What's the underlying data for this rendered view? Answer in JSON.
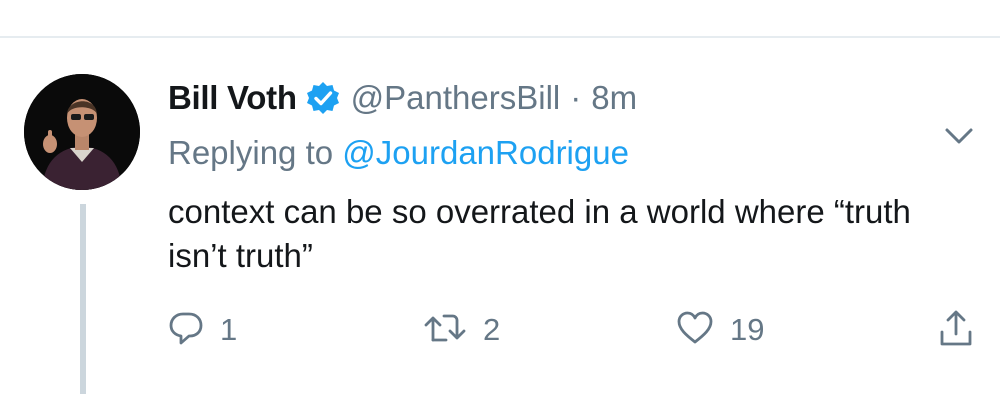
{
  "tweet": {
    "display_name": "Bill Voth",
    "handle": "@PanthersBill",
    "separator": "·",
    "time": "8m",
    "replying_label": "Replying to",
    "replying_to": "@JourdanRodrigue",
    "text": "context can be so overrated in a world where “truth isn’t truth”",
    "reply_count": "1",
    "retweet_count": "2",
    "like_count": "19"
  },
  "icons": {
    "verified": "verified-badge-icon",
    "menu": "chevron-down-icon",
    "reply": "reply-icon",
    "retweet": "retweet-icon",
    "like": "heart-icon",
    "share": "share-icon"
  },
  "colors": {
    "accent": "#1da1f2",
    "secondary_text": "#657786",
    "primary_text": "#14171a",
    "thread_line": "#ccd6dd"
  }
}
